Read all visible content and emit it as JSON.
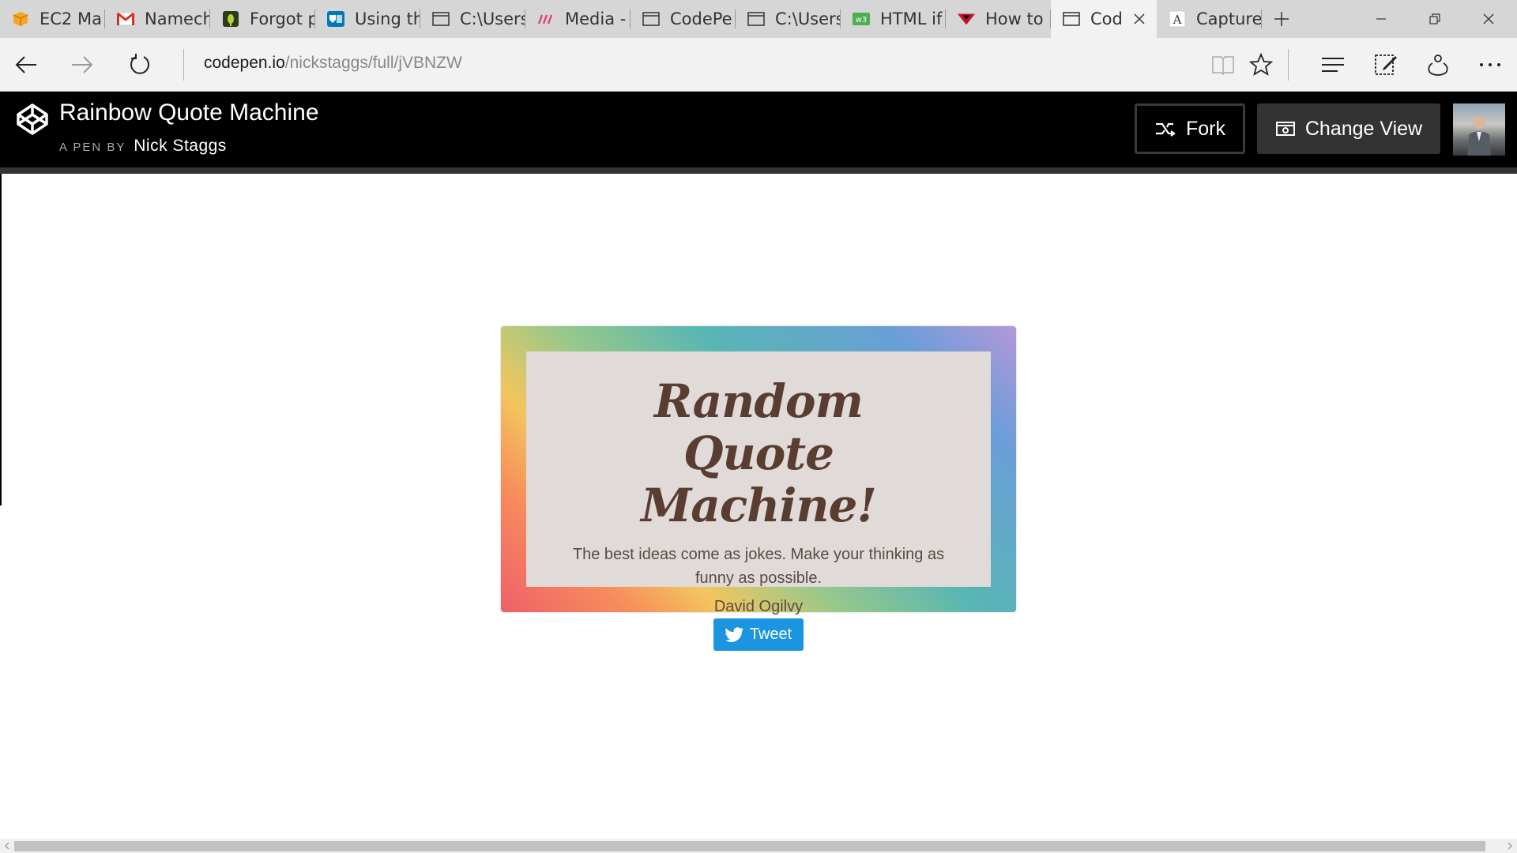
{
  "browser": {
    "tabs": [
      {
        "label": "EC2 Ma",
        "icon": "aws-box-icon"
      },
      {
        "label": "Namech",
        "icon": "gmail-icon"
      },
      {
        "label": "Forgot p",
        "icon": "bug-icon"
      },
      {
        "label": "Using th",
        "icon": "trello-icon"
      },
      {
        "label": "C:\\Users",
        "icon": "page-icon"
      },
      {
        "label": "Media -",
        "icon": "medium-icon"
      },
      {
        "label": "CodePe",
        "icon": "page-icon"
      },
      {
        "label": "C:\\Users",
        "icon": "page-icon"
      },
      {
        "label": "HTML if",
        "icon": "w3schools-icon"
      },
      {
        "label": "How to",
        "icon": "red-logo-icon"
      },
      {
        "label": "Cod",
        "icon": "page-icon",
        "active": true
      },
      {
        "label": "Capture",
        "icon": "font-a-icon"
      }
    ],
    "url_host": "codepen.io",
    "url_path": "/nickstaggs/full/jVBNZW"
  },
  "codepen": {
    "title": "Rainbow Quote Machine",
    "byline": "A PEN BY",
    "author": "Nick Staggs",
    "fork_label": "Fork",
    "change_view_label": "Change View"
  },
  "quote": {
    "heading": "Random Quote Machine!",
    "text": "The best ideas come as jokes. Make your thinking as funny as possible.",
    "author": "David Ogilvy",
    "tweet_label": "Tweet"
  },
  "colors": {
    "header_bg": "#000000",
    "quote_inner_bg": "#e0dad8",
    "heading_color": "#5a3d31",
    "tweet_blue": "#1b95e0"
  }
}
